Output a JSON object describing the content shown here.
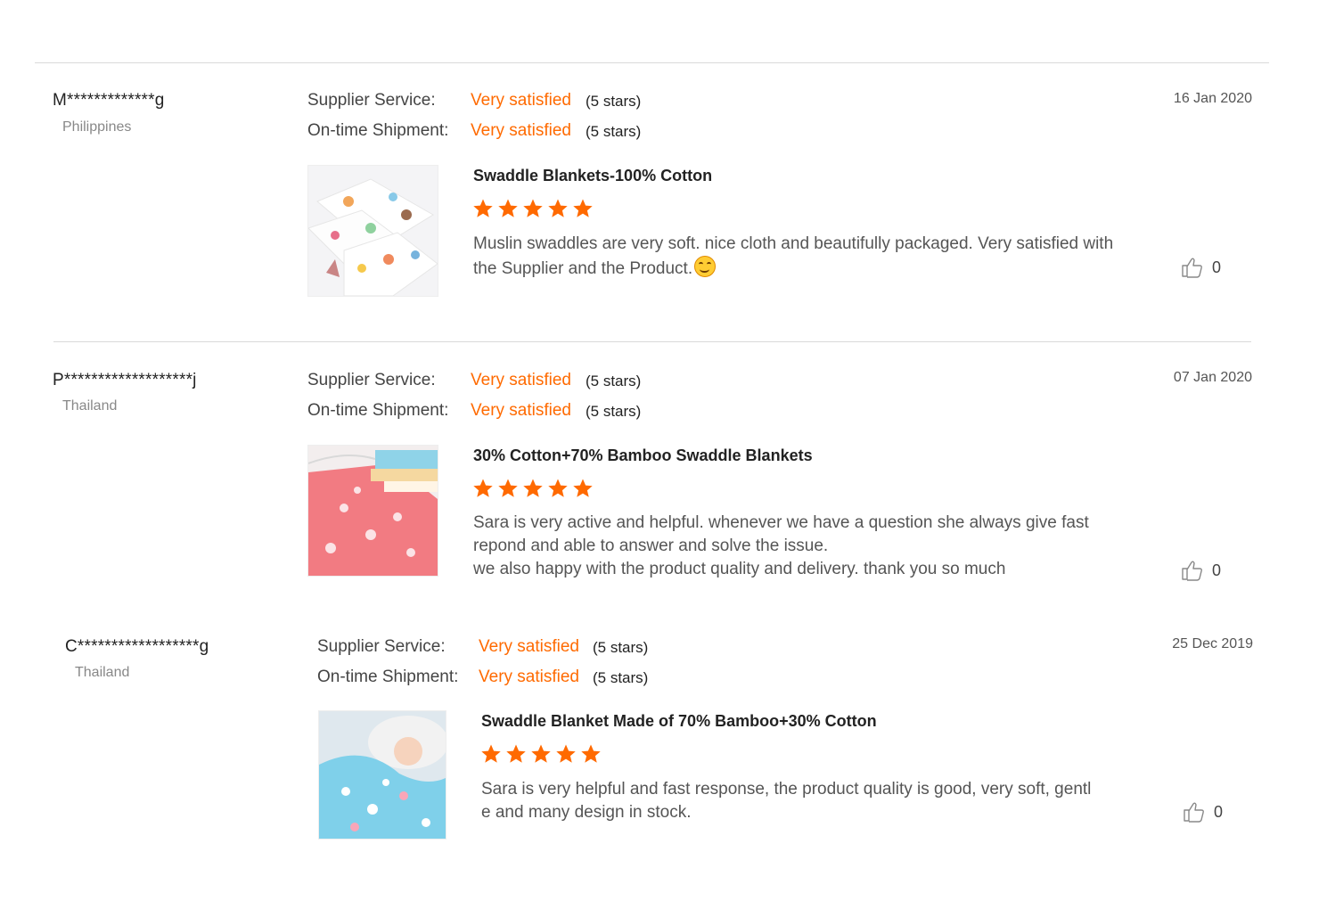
{
  "colors": {
    "accent": "#ff6a00",
    "divider": "#d9d9d9"
  },
  "reviews": [
    {
      "buyer": "M*************g",
      "country": "Philippines",
      "supplier_service_label": "Supplier Service:",
      "supplier_service_value": "Very satisfied",
      "supplier_service_stars": "(5 stars)",
      "shipment_label": "On-time Shipment:",
      "shipment_value": "Very satisfied",
      "shipment_stars": "(5 stars)",
      "product_title": "Swaddle Blankets-100% Cotton",
      "rating": 5,
      "text": "Muslin swaddles are very soft. nice cloth and beautifully packaged. Very satisfied with the Supplier and the Product.",
      "date": "16 Jan 2020",
      "likes": "0"
    },
    {
      "buyer": "P*******************j",
      "country": "Thailand",
      "supplier_service_label": "Supplier Service:",
      "supplier_service_value": "Very satisfied",
      "supplier_service_stars": "(5 stars)",
      "shipment_label": "On-time Shipment:",
      "shipment_value": "Very satisfied",
      "shipment_stars": "(5 stars)",
      "product_title": "30% Cotton+70% Bamboo Swaddle Blankets",
      "rating": 5,
      "text": "Sara is very active and helpful. whenever we have a question she always give fast repond and able to answer and solve the issue.\nwe also happy with the product quality and delivery. thank you so much",
      "date": "07 Jan 2020",
      "likes": "0"
    },
    {
      "buyer": "C******************g",
      "country": "Thailand",
      "supplier_service_label": "Supplier Service:",
      "supplier_service_value": "Very satisfied",
      "supplier_service_stars": "(5 stars)",
      "shipment_label": "On-time Shipment:",
      "shipment_value": "Very satisfied",
      "shipment_stars": "(5 stars)",
      "product_title": "Swaddle Blanket Made of 70% Bamboo+30% Cotton",
      "rating": 5,
      "text": "Sara is very helpful and fast response, the product quality is good, very soft, gentl e and many design in stock.",
      "date": "25 Dec 2019",
      "likes": "0"
    }
  ]
}
